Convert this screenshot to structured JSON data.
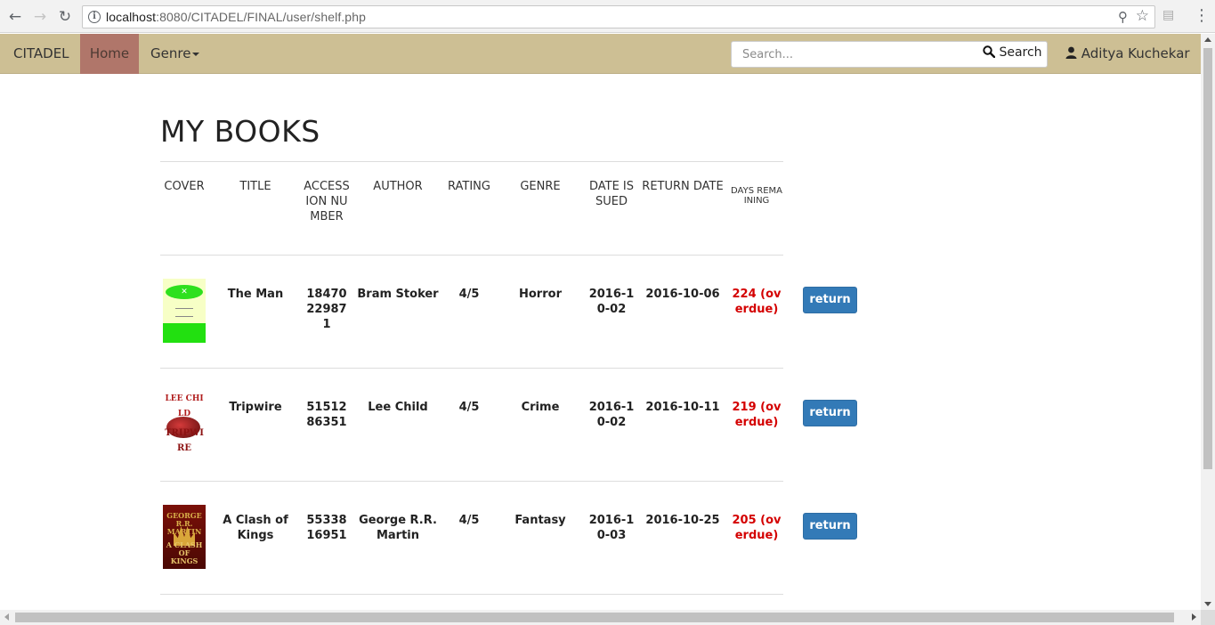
{
  "browser": {
    "url_host": "localhost",
    "url_rest": ":8080/CITADEL/FINAL/user/shelf.php"
  },
  "navbar": {
    "brand": "CITADEL",
    "home": "Home",
    "genre": "Genre",
    "search_placeholder": "Search...",
    "search_button": "Search",
    "user": "Aditya Kuchekar"
  },
  "page": {
    "title": "MY BOOKS"
  },
  "table": {
    "headers": {
      "cover": "COVER",
      "title": "TITLE",
      "accession": "ACCESSION NUMBER",
      "author": "AUTHOR",
      "rating": "RATING",
      "genre": "GENRE",
      "date_issued": "DATE ISSUED",
      "return_date": "RETURN DATE",
      "days_remaining": "DAYS REMAINING"
    },
    "rows": [
      {
        "title": "The Man",
        "accession": "18470229871",
        "author": "Bram Stoker",
        "rating": "4/5",
        "genre": "Horror",
        "date_issued": "2016-10-02",
        "return_date": "2016-10-06",
        "days": "224 (overdue)",
        "action": "return"
      },
      {
        "title": "Tripwire",
        "accession": "5151286351",
        "author": "Lee Child",
        "rating": "4/5",
        "genre": "Crime",
        "date_issued": "2016-10-02",
        "return_date": "2016-10-11",
        "days": "219 (overdue)",
        "action": "return"
      },
      {
        "title": "A Clash of Kings",
        "accession": "5533816951",
        "author": "George R.R. Martin",
        "rating": "4/5",
        "genre": "Fantasy",
        "date_issued": "2016-10-03",
        "return_date": "2016-10-25",
        "days": "205 (overdue)",
        "action": "return"
      }
    ]
  },
  "icons": {
    "back": "arrow-left-icon",
    "forward": "arrow-right-icon",
    "reload": "reload-icon",
    "info": "info-icon",
    "zoom": "zoom-icon",
    "bookmark": "star-icon",
    "search": "magnifier-icon",
    "user": "user-icon"
  },
  "colors": {
    "navbar": "#cdbf94",
    "home_active": "#b0766a",
    "overdue": "#d40000",
    "button": "#337ab7"
  }
}
